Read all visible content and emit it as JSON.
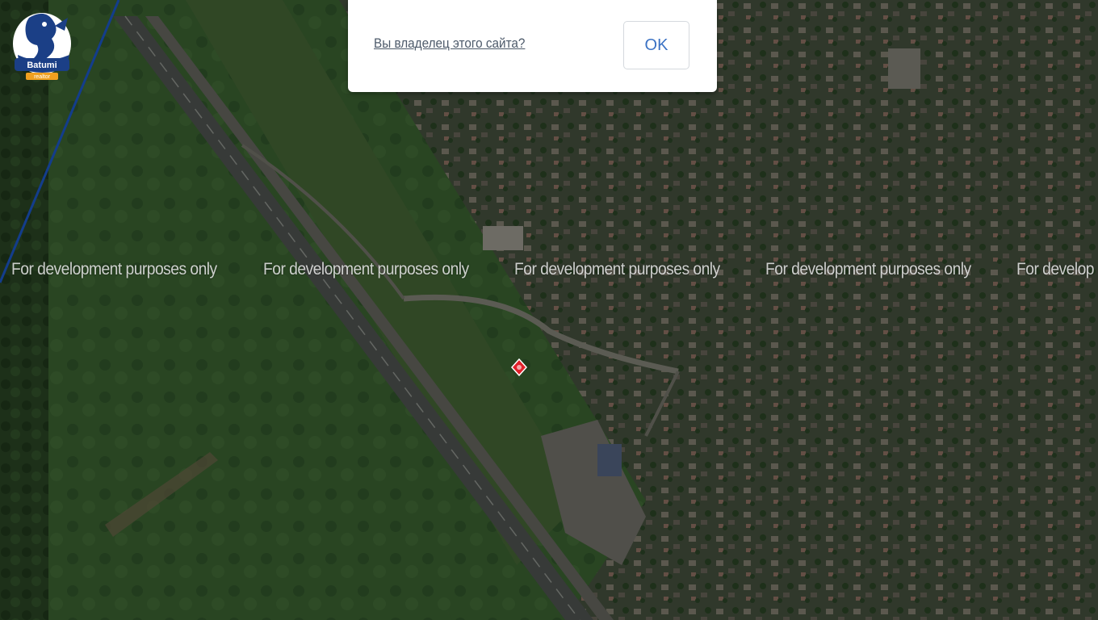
{
  "logo": {
    "text": "Batumi",
    "subtext": "realtor",
    "icon": "seahorse-logo-icon"
  },
  "dialog": {
    "owner_link": "Вы владелец этого сайта?",
    "ok_label": "OK"
  },
  "map": {
    "watermark_text": "For development purposes only",
    "watermark_partial": "For develop",
    "marker_icon": "map-marker-icon",
    "colors": {
      "route_line": "#1e5fd8",
      "marker": "#e0202a",
      "ok_text": "#3b72c4"
    }
  }
}
